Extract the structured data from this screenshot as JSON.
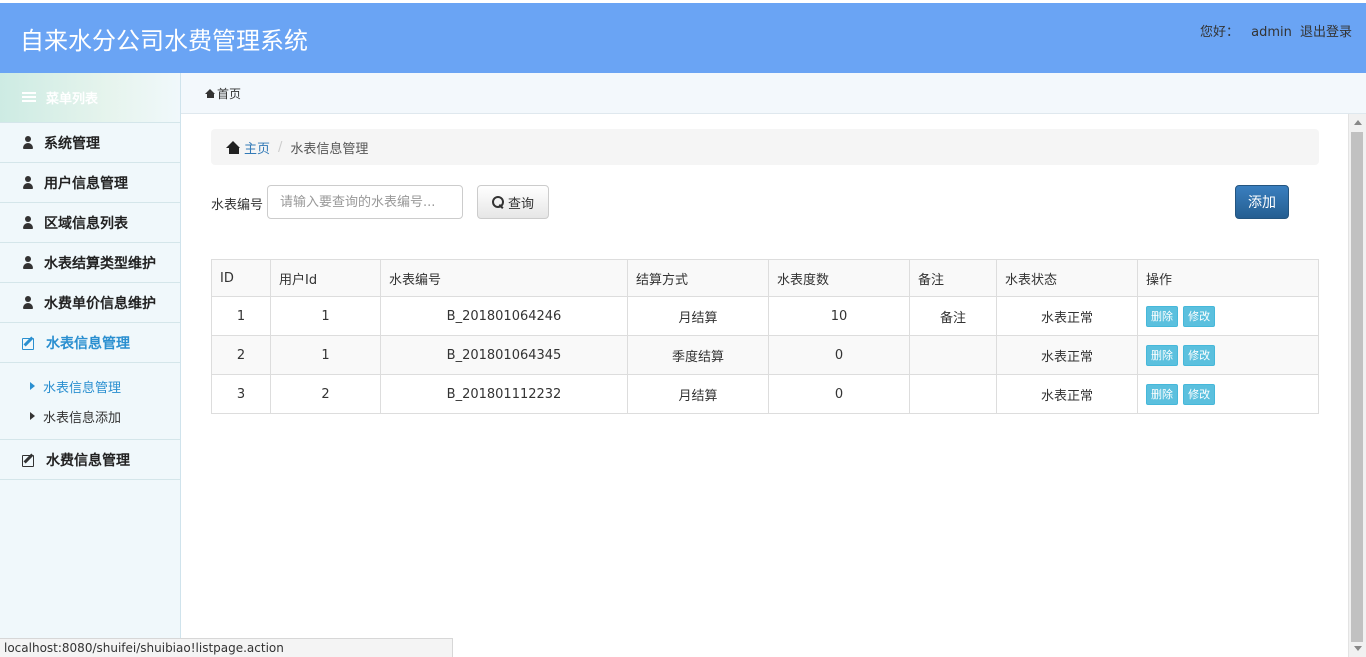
{
  "header": {
    "app_title": "自来水分公司水费管理系统",
    "greeting": "您好：",
    "username": "admin",
    "logout": "退出登录"
  },
  "sidebar": {
    "menu_title": "菜单列表",
    "items": [
      {
        "label": "系统管理",
        "icon": "user-icon"
      },
      {
        "label": "用户信息管理",
        "icon": "user-icon"
      },
      {
        "label": "区域信息列表",
        "icon": "user-icon"
      },
      {
        "label": "水表结算类型维护",
        "icon": "user-icon"
      },
      {
        "label": "水费单价信息维护",
        "icon": "user-icon"
      },
      {
        "label": "水表信息管理",
        "icon": "edit-icon",
        "active": true
      },
      {
        "label": "水费信息管理",
        "icon": "edit-icon"
      }
    ],
    "submenu": [
      {
        "label": "水表信息管理",
        "active": true
      },
      {
        "label": "水表信息添加"
      }
    ]
  },
  "topnav": {
    "home_label": "首页"
  },
  "breadcrumb": {
    "home": "主页",
    "current": "水表信息管理"
  },
  "search": {
    "label": "水表编号",
    "placeholder": "请输入要查询的水表编号...",
    "button": "查询"
  },
  "add_button": "添加",
  "table": {
    "headers": [
      "ID",
      "用户Id",
      "水表编号",
      "结算方式",
      "水表度数",
      "备注",
      "水表状态",
      "操作"
    ],
    "rows": [
      {
        "id": "1",
        "user_id": "1",
        "meter_no": "B_201801064246",
        "settle": "月结算",
        "reading": "10",
        "note": "备注",
        "status": "水表正常"
      },
      {
        "id": "2",
        "user_id": "1",
        "meter_no": "B_201801064345",
        "settle": "季度结算",
        "reading": "0",
        "note": "",
        "status": "水表正常"
      },
      {
        "id": "3",
        "user_id": "2",
        "meter_no": "B_201801112232",
        "settle": "月结算",
        "reading": "0",
        "note": "",
        "status": "水表正常"
      }
    ],
    "delete_label": "删除",
    "edit_label": "修改"
  },
  "statusbar": {
    "url": "localhost:8080/shuifei/shuibiao!listpage.action"
  },
  "colors": {
    "header_bg": "#6aa4f4",
    "accent": "#2a8fd0",
    "add_button": "#286090",
    "op_button": "#5bc0de"
  }
}
